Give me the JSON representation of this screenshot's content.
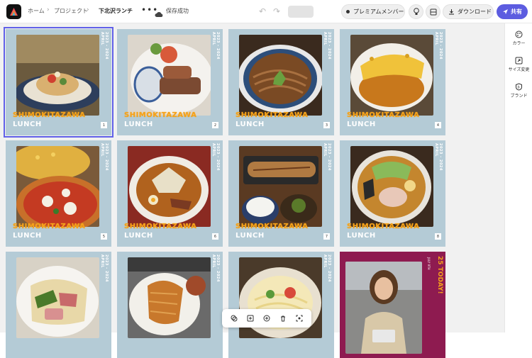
{
  "topbar": {
    "breadcrumb": [
      "ホーム",
      "プロジェクト",
      "下北沢ランチ"
    ],
    "more_label": "•••",
    "save_status": "保存成功",
    "premium_label": "プレミアムメンバー",
    "download_label": "ダウンロード",
    "share_label": "共有"
  },
  "rail": {
    "items": [
      "カラー",
      "サイズ変更",
      "ブランド"
    ]
  },
  "cards": [
    {
      "title": "SHIMOKITAZAWA",
      "subtitle": "LUNCH",
      "side": "2023 - 2024 APRIL",
      "page": "1"
    },
    {
      "title": "SHIMOKITAZAWA",
      "subtitle": "LUNCH",
      "side": "2023 - 2024 APRIL",
      "page": "2"
    },
    {
      "title": "SHIMOKITAZAWA",
      "subtitle": "LUNCH",
      "side": "2023 - 2024 APRIL",
      "page": "3"
    },
    {
      "title": "SHIMOKITAZAWA",
      "subtitle": "LUNCH",
      "side": "2023 - 2024 APRIL",
      "page": "4"
    },
    {
      "title": "SHIMOKITAZAWA",
      "subtitle": "LUNCH",
      "side": "2023 - 2024 APRIL",
      "page": "5"
    },
    {
      "title": "SHIMOKITAZAWA",
      "subtitle": "LUNCH",
      "side": "2023 - 2024 APRIL",
      "page": "6"
    },
    {
      "title": "SHIMOKITAZAWA",
      "subtitle": "LUNCH",
      "side": "2023 - 2024 APRIL",
      "page": "7"
    },
    {
      "title": "SHIMOKITAZAWA",
      "subtitle": "LUNCH",
      "side": "2023 - 2024 APRIL",
      "page": "8"
    },
    {
      "side": "2023 - 2024 APRIL"
    },
    {
      "side": "2023 - 2024 APRIL"
    },
    {
      "side": "2023 - 2024 APRIL"
    },
    {
      "title": "25 TODAY!",
      "side": "JULY 9TH"
    }
  ],
  "toolbar": {
    "buttons": [
      "duplicate-icon",
      "add-page-icon",
      "copy-icon",
      "trash-icon",
      "select-icon"
    ]
  },
  "colors": {
    "accent": "#5c5ce0",
    "card_bg": "#b4cbd6",
    "title_orange": "#f5a21a",
    "special_bg": "#8e1b50"
  }
}
